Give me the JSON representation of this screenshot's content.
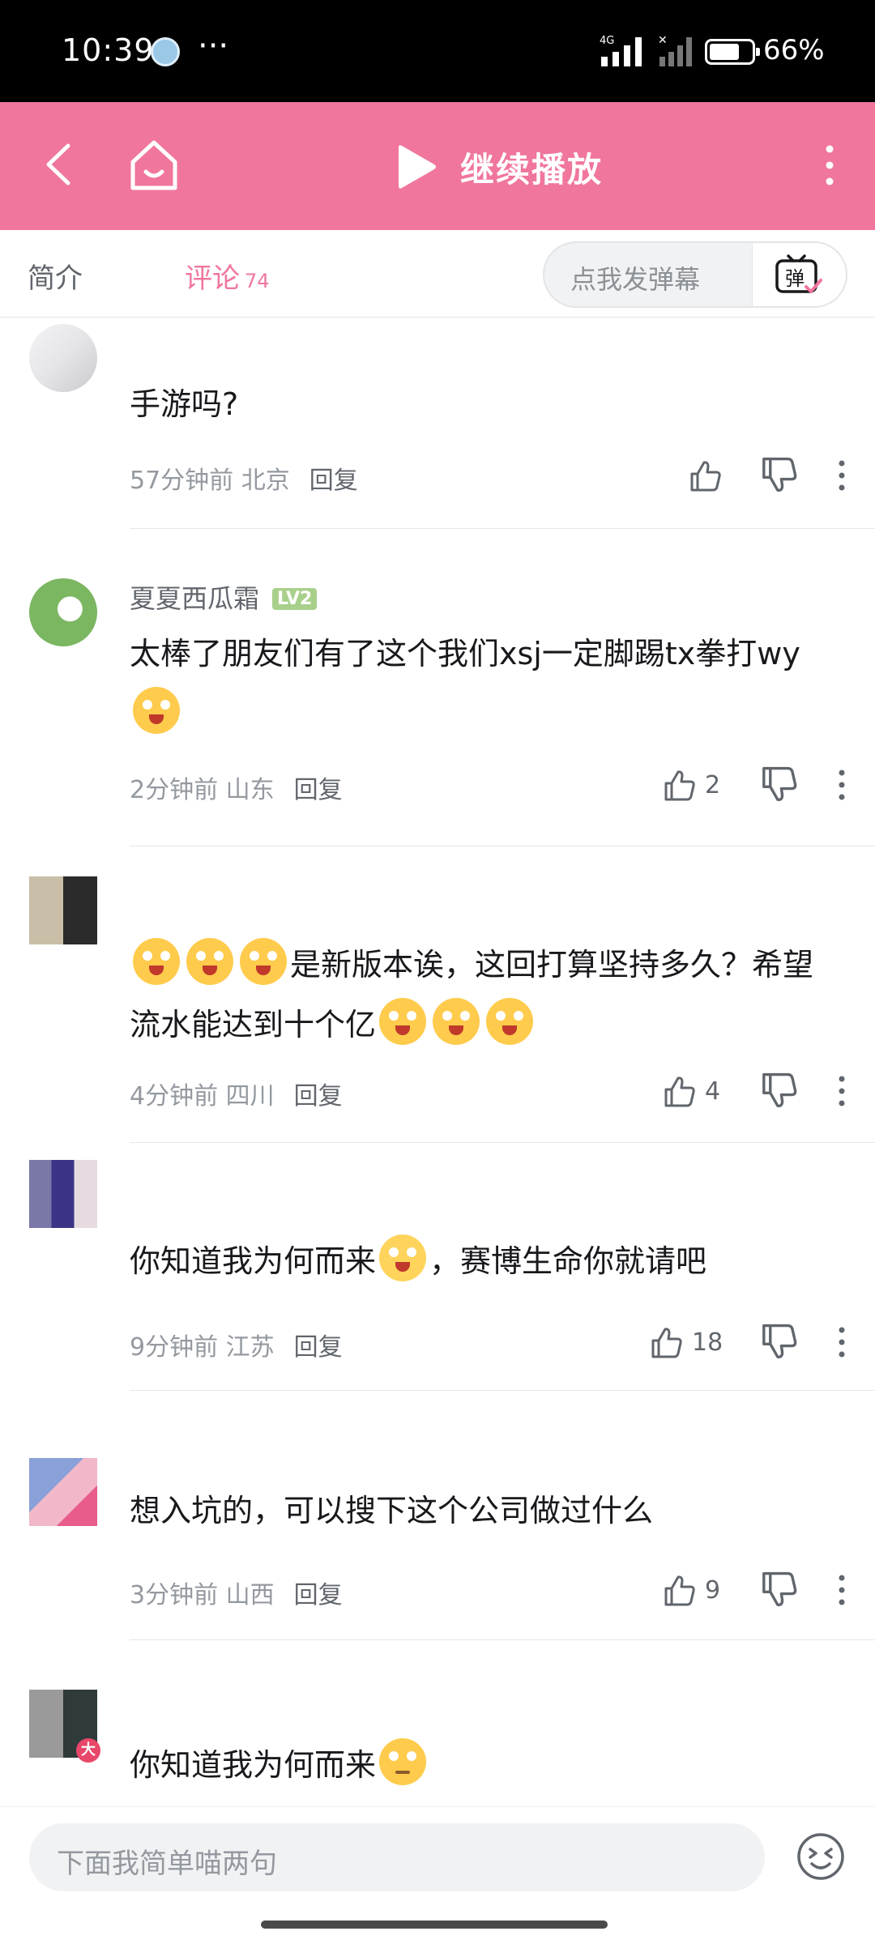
{
  "status_bar": {
    "time": "10:39",
    "dots": "···",
    "network": "4G",
    "battery": "66%"
  },
  "header": {
    "resume_label": "继续播放"
  },
  "tabs": {
    "intro": "简介",
    "comments": "评论",
    "comments_count": "74"
  },
  "danmaku": {
    "placeholder": "点我发弹幕",
    "button_label": "弹"
  },
  "comments": [
    {
      "username": "",
      "content": "手游吗?",
      "time": "57分钟前",
      "location": "北京",
      "reply": "回复",
      "likes": ""
    },
    {
      "username": "夏夏西瓜霜",
      "level": "LV2",
      "content": "太棒了朋友们有了这个我们xsj一定脚踢tx拳打wy",
      "time": "2分钟前",
      "location": "山东",
      "reply": "回复",
      "likes": "2"
    },
    {
      "username": "",
      "content": "是新版本诶，这回打算坚持多久？希望流水能达到十个亿",
      "time": "4分钟前",
      "location": "四川",
      "reply": "回复",
      "likes": "4"
    },
    {
      "username": "",
      "content_a": "你知道我为何而来",
      "content_b": "，赛博生命你就请吧",
      "time": "9分钟前",
      "location": "江苏",
      "reply": "回复",
      "likes": "18"
    },
    {
      "username": "",
      "content": "想入坑的，可以搜下这个公司做过什么",
      "time": "3分钟前",
      "location": "山西",
      "reply": "回复",
      "likes": "9"
    },
    {
      "username": "",
      "avatar_badge": "大",
      "content": "你知道我为何而来"
    }
  ],
  "bottom_bar": {
    "placeholder": "下面我简单喵两句"
  },
  "colors": {
    "brand_pink": "#f0769c",
    "text_secondary": "#9499a0"
  }
}
